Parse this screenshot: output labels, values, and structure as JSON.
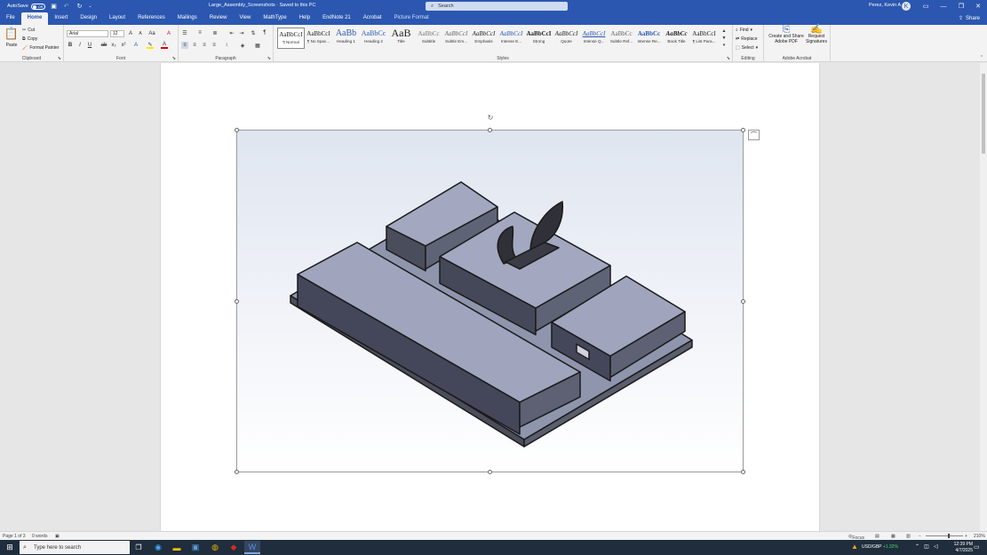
{
  "titlebar": {
    "autosave_label": "AutoSave",
    "autosave_state": "Off",
    "doc_title": "Large_Assembly_Screenshots  ·  Saved to this PC",
    "search_placeholder": "Search",
    "user_name": "Perez, Kevin A",
    "avatar_initial": "K"
  },
  "tabs": [
    "File",
    "Home",
    "Insert",
    "Design",
    "Layout",
    "References",
    "Mailings",
    "Review",
    "View",
    "MathType",
    "Help",
    "EndNote 21",
    "Acrobat",
    "Picture Format"
  ],
  "share_label": "Share",
  "clipboard": {
    "label": "Clipboard",
    "paste": "Paste",
    "cut": "Cut",
    "copy": "Copy",
    "format_painter": "Format Painter"
  },
  "font": {
    "label": "Font",
    "family": "Arial",
    "size": "12"
  },
  "paragraph": {
    "label": "Paragraph"
  },
  "styles": {
    "label": "Styles",
    "items": [
      {
        "preview": "AaBbCcI",
        "name": "¶ Normal"
      },
      {
        "preview": "AaBbCcI",
        "name": "¶ No Spac..."
      },
      {
        "preview": "AaBb",
        "name": "Heading 1"
      },
      {
        "preview": "AaBbCc",
        "name": "Heading 2"
      },
      {
        "preview": "AaB",
        "name": "Title"
      },
      {
        "preview": "AaBbCc",
        "name": "Subtitle"
      },
      {
        "preview": "AaBbCcI",
        "name": "Subtle Em..."
      },
      {
        "preview": "AaBbCcI",
        "name": "Emphasis"
      },
      {
        "preview": "AaBbCcI",
        "name": "Intense E..."
      },
      {
        "preview": "AaBbCcI",
        "name": "Strong"
      },
      {
        "preview": "AaBbCcI",
        "name": "Quote"
      },
      {
        "preview": "AaBbCcI",
        "name": "Intense Q..."
      },
      {
        "preview": "AaBbCc",
        "name": "Subtle Ref..."
      },
      {
        "preview": "AaBbCc",
        "name": "Intense Re..."
      },
      {
        "preview": "AaBbCc",
        "name": "Book Title"
      },
      {
        "preview": "AaBbCcI",
        "name": "¶ List Para..."
      }
    ]
  },
  "editing": {
    "label": "Editing",
    "find": "Find",
    "replace": "Replace",
    "select": "Select"
  },
  "acrobat": {
    "label": "Adobe Acrobat",
    "create_share": "Create and Share Adobe PDF",
    "request_signatures": "Request Signatures"
  },
  "statusbar": {
    "page": "Page 1 of 3",
    "words": "0 words",
    "focus": "Focus",
    "zoom": "210%"
  },
  "taskbar": {
    "search_placeholder": "Type here to search",
    "currency": "USD/GBP",
    "currency_change": "+1.32%",
    "time": "12:39 PM",
    "date": "4/7/2025"
  }
}
